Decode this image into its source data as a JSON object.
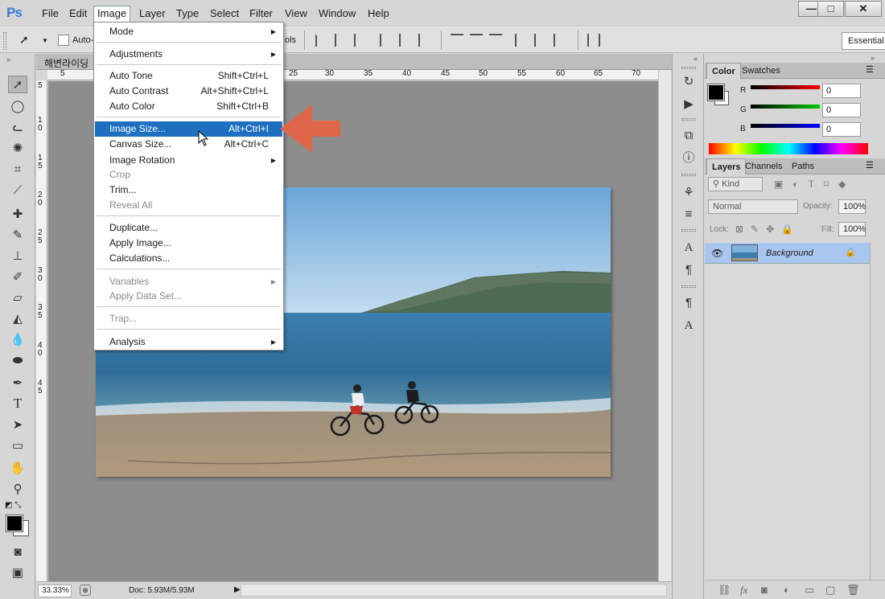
{
  "app": {
    "logo": "Ps"
  },
  "menubar": {
    "items": [
      "File",
      "Edit",
      "Image",
      "Layer",
      "Type",
      "Select",
      "Filter",
      "View",
      "Window",
      "Help"
    ],
    "active": "Image",
    "window_buttons": {
      "minimize": "—",
      "maximize": "□",
      "close": "✕"
    }
  },
  "options_bar": {
    "auto_select_label": "Auto-",
    "hidden_label_tail": "ols",
    "workspace": "Essential"
  },
  "document": {
    "tab_title": "해변라이딩",
    "ruler_top": [
      "5",
      "25",
      "30",
      "35",
      "40",
      "45",
      "50",
      "55",
      "60",
      "65",
      "70"
    ],
    "ruler_left": [
      "5",
      "10",
      "15",
      "20",
      "25",
      "30",
      "35",
      "40",
      "45"
    ],
    "zoom": "33.33%",
    "doc_size": "Doc: 5.93M/5.93M"
  },
  "image_menu": {
    "items": [
      {
        "label": "Mode",
        "shortcut": "",
        "submenu": true,
        "disabled": false
      },
      {
        "label": "Adjustments",
        "shortcut": "",
        "submenu": true,
        "disabled": false
      },
      {
        "label": "Auto Tone",
        "shortcut": "Shift+Ctrl+L",
        "submenu": false,
        "disabled": false
      },
      {
        "label": "Auto Contrast",
        "shortcut": "Alt+Shift+Ctrl+L",
        "submenu": false,
        "disabled": false
      },
      {
        "label": "Auto Color",
        "shortcut": "Shift+Ctrl+B",
        "submenu": false,
        "disabled": false
      },
      {
        "label": "Image Size...",
        "shortcut": "Alt+Ctrl+I",
        "submenu": false,
        "disabled": false,
        "highlighted": true
      },
      {
        "label": "Canvas Size...",
        "shortcut": "Alt+Ctrl+C",
        "submenu": false,
        "disabled": false
      },
      {
        "label": "Image Rotation",
        "shortcut": "",
        "submenu": true,
        "disabled": false
      },
      {
        "label": "Crop",
        "shortcut": "",
        "submenu": false,
        "disabled": true
      },
      {
        "label": "Trim...",
        "shortcut": "",
        "submenu": false,
        "disabled": false
      },
      {
        "label": "Reveal All",
        "shortcut": "",
        "submenu": false,
        "disabled": true
      },
      {
        "label": "Duplicate...",
        "shortcut": "",
        "submenu": false,
        "disabled": false
      },
      {
        "label": "Apply Image...",
        "shortcut": "",
        "submenu": false,
        "disabled": false
      },
      {
        "label": "Calculations...",
        "shortcut": "",
        "submenu": false,
        "disabled": false
      },
      {
        "label": "Variables",
        "shortcut": "",
        "submenu": true,
        "disabled": true
      },
      {
        "label": "Apply Data Set...",
        "shortcut": "",
        "submenu": false,
        "disabled": true
      },
      {
        "label": "Trap...",
        "shortcut": "",
        "submenu": false,
        "disabled": true
      },
      {
        "label": "Analysis",
        "shortcut": "",
        "submenu": true,
        "disabled": false
      }
    ]
  },
  "color_panel": {
    "tabs": [
      "Color",
      "Swatches"
    ],
    "channels": [
      {
        "label": "R",
        "value": "0",
        "color": "#ff0000"
      },
      {
        "label": "G",
        "value": "0",
        "color": "#00cc00"
      },
      {
        "label": "B",
        "value": "0",
        "color": "#0000ff"
      }
    ]
  },
  "layers_panel": {
    "tabs": [
      "Layers",
      "Channels",
      "Paths"
    ],
    "filter_kind": "Kind",
    "blend_mode": "Normal",
    "opacity_label": "Opacity:",
    "opacity": "100%",
    "lock_label": "Lock:",
    "fill_label": "Fill:",
    "fill": "100%",
    "layers": [
      {
        "name": "Background",
        "visible": true,
        "locked": true
      }
    ]
  },
  "colors": {
    "highlight": "#1f6fc1",
    "annotation_arrow": "#e0664a",
    "ps_blue": "#3b7bd4"
  }
}
